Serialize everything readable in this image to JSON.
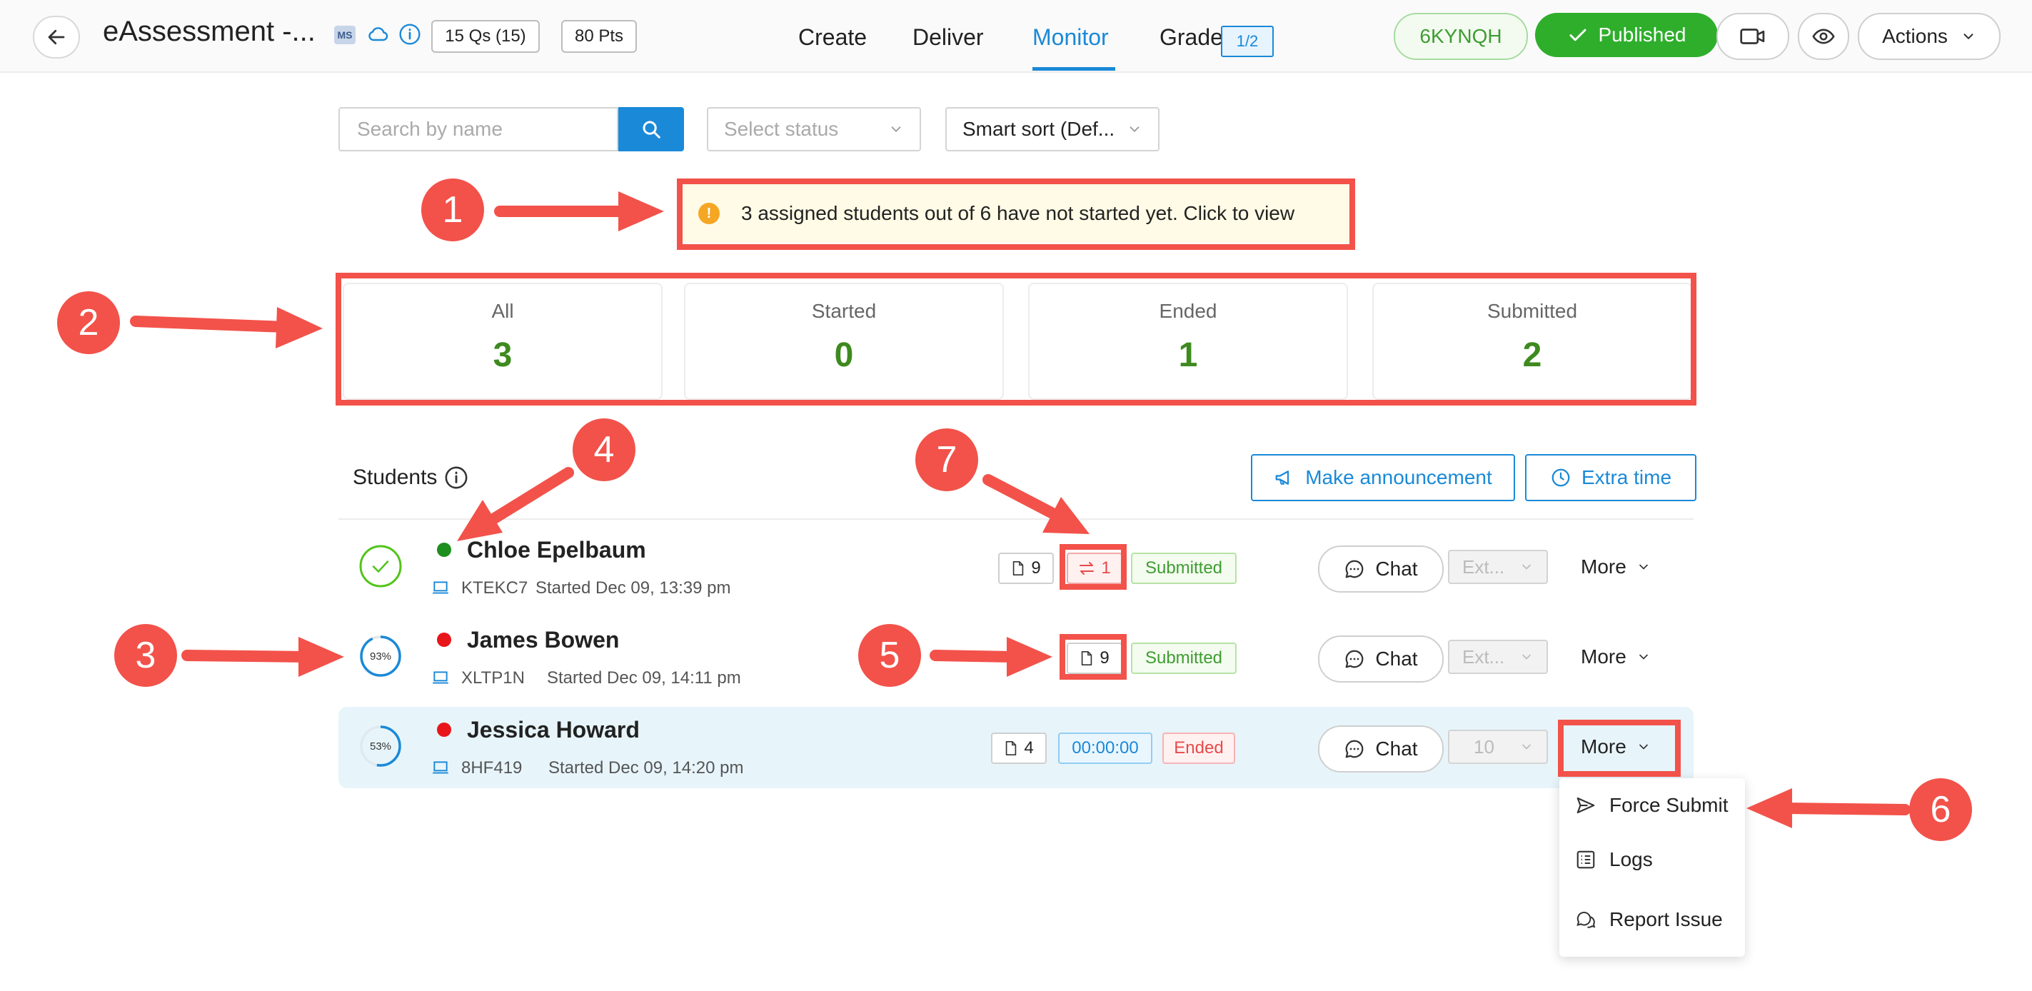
{
  "header": {
    "title": "eAssessment -...",
    "ms_badge": "MS",
    "questions_chip": "15 Qs (15)",
    "points_chip": "80 Pts",
    "nav": [
      {
        "label": "Create",
        "active": false
      },
      {
        "label": "Deliver",
        "active": false
      },
      {
        "label": "Monitor",
        "active": true
      },
      {
        "label": "Grade",
        "active": false
      }
    ],
    "grade_badge": "1/2",
    "access_code": "6KYNQH",
    "published_label": "Published",
    "actions_label": "Actions"
  },
  "filters": {
    "search_placeholder": "Search by name",
    "status_placeholder": "Select status",
    "sort_value": "Smart sort (Def..."
  },
  "notice": {
    "text": "3 assigned students out of 6 have not started yet. Click to view",
    "icon": "!"
  },
  "stats": [
    {
      "label": "All",
      "value": "3"
    },
    {
      "label": "Started",
      "value": "0"
    },
    {
      "label": "Ended",
      "value": "1"
    },
    {
      "label": "Submitted",
      "value": "2"
    }
  ],
  "students_section": {
    "title": "Students",
    "announce_label": "Make announcement",
    "extra_time_label": "Extra time"
  },
  "students": [
    {
      "name": "Chloe Epelbaum",
      "device_code": "KTEKC7",
      "started": "Started Dec 09, 13:39 pm",
      "online": true,
      "progress": "complete",
      "answered": "9",
      "switches": "1",
      "status": "Submitted",
      "chat_label": "Chat",
      "extra_select": "Ext...",
      "more_label": "More"
    },
    {
      "name": "James Bowen",
      "device_code": "XLTP1N",
      "started": "Started Dec 09, 14:11 pm",
      "online": false,
      "progress_percent": "93%",
      "progress_fraction": 0.93,
      "answered": "9",
      "status": "Submitted",
      "chat_label": "Chat",
      "extra_select": "Ext...",
      "more_label": "More"
    },
    {
      "name": "Jessica Howard",
      "device_code": "8HF419",
      "started": "Started Dec 09, 14:20 pm",
      "online": false,
      "progress_percent": "53%",
      "progress_fraction": 0.53,
      "answered": "4",
      "timer": "00:00:00",
      "status": "Ended",
      "chat_label": "Chat",
      "extra_select": "10",
      "more_label": "More"
    }
  ],
  "more_menu": [
    {
      "label": "Force Submit",
      "icon": "send-icon"
    },
    {
      "label": "Logs",
      "icon": "list-icon"
    },
    {
      "label": "Report Issue",
      "icon": "chat-bubbles-icon"
    }
  ],
  "annotations": [
    "1",
    "2",
    "3",
    "4",
    "5",
    "6",
    "7"
  ],
  "colors": {
    "accent": "#1a89d8",
    "success": "#2fae2c",
    "stat_value": "#3f8a1f",
    "danger": "#e84a4a",
    "annotation": "#f2524a",
    "online": "#1e8f1e",
    "offline": "#e8161b"
  }
}
